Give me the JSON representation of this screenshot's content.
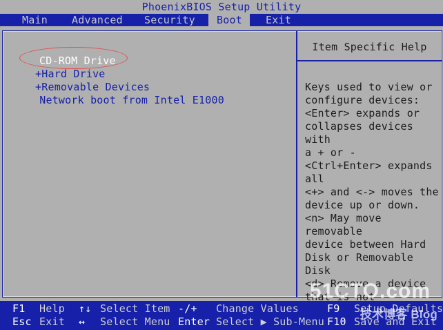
{
  "title": "PhoenixBIOS Setup Utility",
  "menu": {
    "main": "Main",
    "advanced": "Advanced",
    "security": "Security",
    "boot": "Boot",
    "exit": "Exit"
  },
  "boot_list": [
    {
      "label": "CD-ROM Drive"
    },
    {
      "label": "+Hard Drive"
    },
    {
      "label": "+Removable Devices"
    },
    {
      "label": " Network boot from Intel E1000"
    }
  ],
  "help": {
    "title": "Item Specific Help",
    "text": "Keys used to view or\nconfigure devices:\n<Enter> expands or\ncollapses devices with\na + or -\n<Ctrl+Enter> expands\nall\n<+> and <-> moves the\ndevice up or down.\n<n> May move removable\ndevice between Hard\nDisk or Removable Disk\n<d> Remove a device\nthat is not installed."
  },
  "footer": {
    "f1_key": "F1",
    "f1_desc": "Help",
    "esc_key": "Esc",
    "esc_desc": "Exit",
    "updown_key": "↑↓",
    "updown_desc": "Select Item",
    "lr_key": "↔",
    "lr_desc": "Select Menu",
    "pm_key": "-/+",
    "pm_desc": "Change Values",
    "enter_key": "Enter",
    "enter_desc": "Select ▶ Sub-Menu",
    "f9_key": "F9",
    "f9_desc": "Setup Defaults",
    "f10_key": "F10",
    "f10_desc": "Save and Exit"
  },
  "watermark": {
    "logo": "51CTO.com",
    "sub": "技术博客 Blog"
  },
  "colors": {
    "bios_blue": "#1620a8",
    "bios_gray": "#b0b0b0",
    "annotation_red": "#e05050"
  }
}
